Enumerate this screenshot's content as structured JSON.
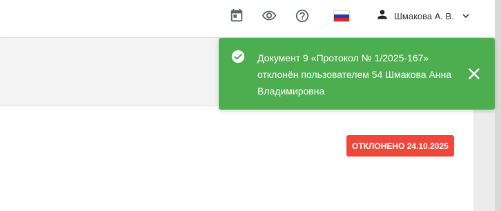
{
  "header": {
    "icons": [
      "calendar-icon",
      "eye-icon",
      "help-icon",
      "russian-flag",
      "person-icon",
      "chevron-down-icon"
    ],
    "user_name": "Шмакова А. В."
  },
  "status_badge": "ОТКЛОНЕНО 24.10.2025",
  "toast": {
    "message": "Документ 9 «Протокол № 1/2025-167» отклонён пользователем 54 Шмакова Анна Владимировна",
    "icons": [
      "check-circle-icon",
      "close-icon"
    ]
  },
  "colors": {
    "toast_background": "#4cae4f",
    "badge_background": "#f0473a",
    "icon_gray": "#5f6368"
  }
}
